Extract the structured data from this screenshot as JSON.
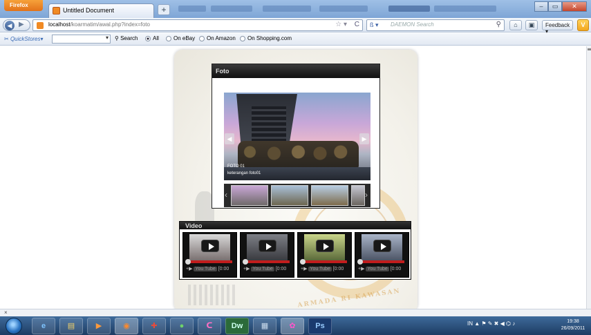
{
  "browser": {
    "app_button": "Firefox",
    "tab_title": "Untitled Document",
    "new_tab": "+",
    "url_host": "localhost",
    "url_path": "/koarmatim/awal.php?index=foto",
    "search_placeholder": "DAEMON Search",
    "feedback_label": "Feedback"
  },
  "quickstores": {
    "label": "QuickStores",
    "search_label": "Search",
    "options": [
      "All",
      "On eBay",
      "On Amazon",
      "On Shopping.com"
    ],
    "selected": "All"
  },
  "page": {
    "foto": {
      "heading": "Foto",
      "caption_title": "FOTO 01",
      "caption_desc": "keterangan foto01"
    },
    "video": {
      "heading": "Video",
      "yt_label": "You Tube",
      "time_label": "0:00"
    },
    "watermark_text": "ARMADA RI KAWASAN"
  },
  "findbar": {
    "close": "×"
  },
  "taskbar": {
    "lang": "IN",
    "time": "19:38",
    "date": "26/09/2011",
    "apps": [
      "ie-icon",
      "explorer-icon",
      "media-player-icon",
      "firefox-icon",
      "app-icon",
      "green-app-icon",
      "pink-app-icon",
      "dreamweaver-icon",
      "notepad-icon",
      "paint-icon",
      "photoshop-icon"
    ]
  },
  "colors": {
    "accent": "#f08a24",
    "titlebar": "#7ea5d6",
    "taskbar": "#1d3c63",
    "video_progress": "#c21d1d"
  }
}
